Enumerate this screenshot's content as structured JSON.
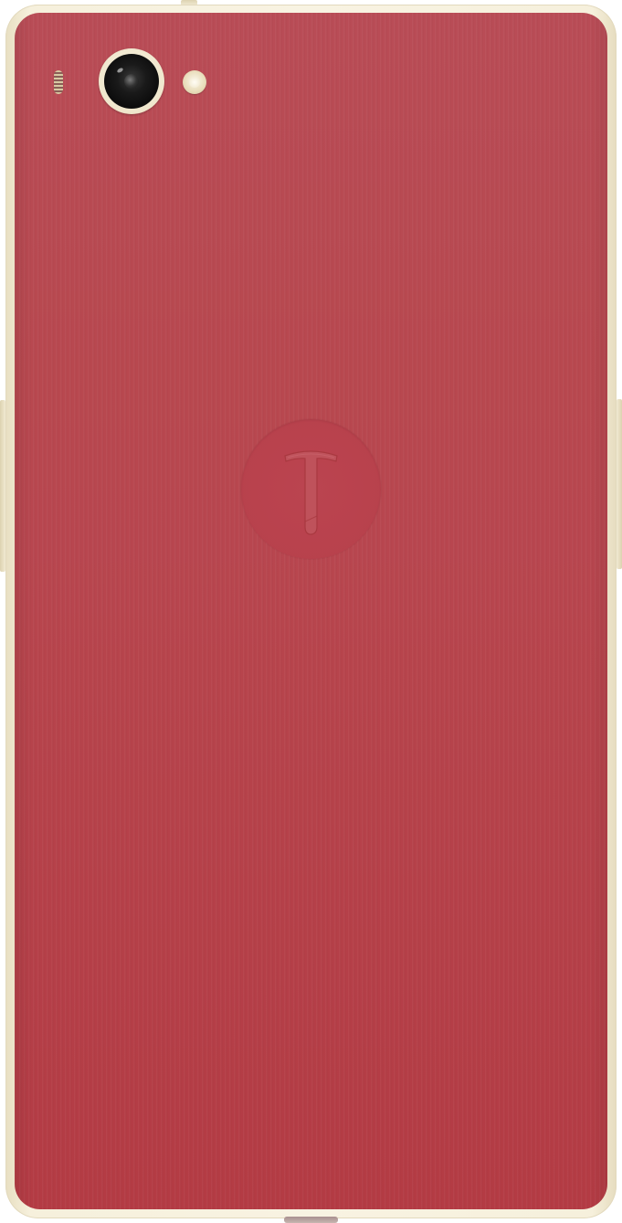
{
  "device": {
    "view": "back",
    "frame_color": "#f6f0dc",
    "panel_color": "#b7464f",
    "logo": {
      "icon": "hammer-t-logo-icon",
      "letter": "T"
    }
  }
}
